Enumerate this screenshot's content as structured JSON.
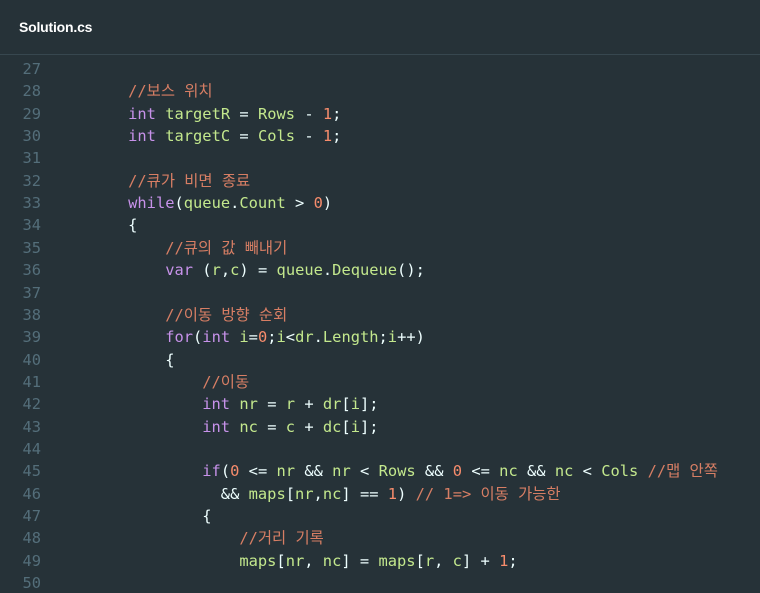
{
  "header": {
    "filename": "Solution.cs"
  },
  "code": {
    "lines": [
      {
        "num": "27",
        "text": ""
      },
      {
        "num": "28",
        "text": "        //보스 위치"
      },
      {
        "num": "29",
        "text": "        int targetR = Rows - 1;"
      },
      {
        "num": "30",
        "text": "        int targetC = Cols - 1;"
      },
      {
        "num": "31",
        "text": ""
      },
      {
        "num": "32",
        "text": "        //큐가 비면 종료"
      },
      {
        "num": "33",
        "text": "        while(queue.Count > 0)"
      },
      {
        "num": "34",
        "text": "        {"
      },
      {
        "num": "35",
        "text": "            //큐의 값 빼내기"
      },
      {
        "num": "36",
        "text": "            var (r,c) = queue.Dequeue();"
      },
      {
        "num": "37",
        "text": ""
      },
      {
        "num": "38",
        "text": "            //이동 방향 순회"
      },
      {
        "num": "39",
        "text": "            for(int i=0;i<dr.Length;i++)"
      },
      {
        "num": "40",
        "text": "            {"
      },
      {
        "num": "41",
        "text": "                //이동"
      },
      {
        "num": "42",
        "text": "                int nr = r + dr[i];"
      },
      {
        "num": "43",
        "text": "                int nc = c + dc[i];"
      },
      {
        "num": "44",
        "text": ""
      },
      {
        "num": "45",
        "text": "                if(0 <= nr && nr < Rows && 0 <= nc && nc < Cols //맵 안쪽"
      },
      {
        "num": "46",
        "text": "                  && maps[nr,nc] == 1) // 1=> 이동 가능한"
      },
      {
        "num": "47",
        "text": "                {"
      },
      {
        "num": "48",
        "text": "                    //거리 기록"
      },
      {
        "num": "49",
        "text": "                    maps[nr, nc] = maps[r, c] + 1;"
      },
      {
        "num": "50",
        "text": ""
      }
    ]
  }
}
